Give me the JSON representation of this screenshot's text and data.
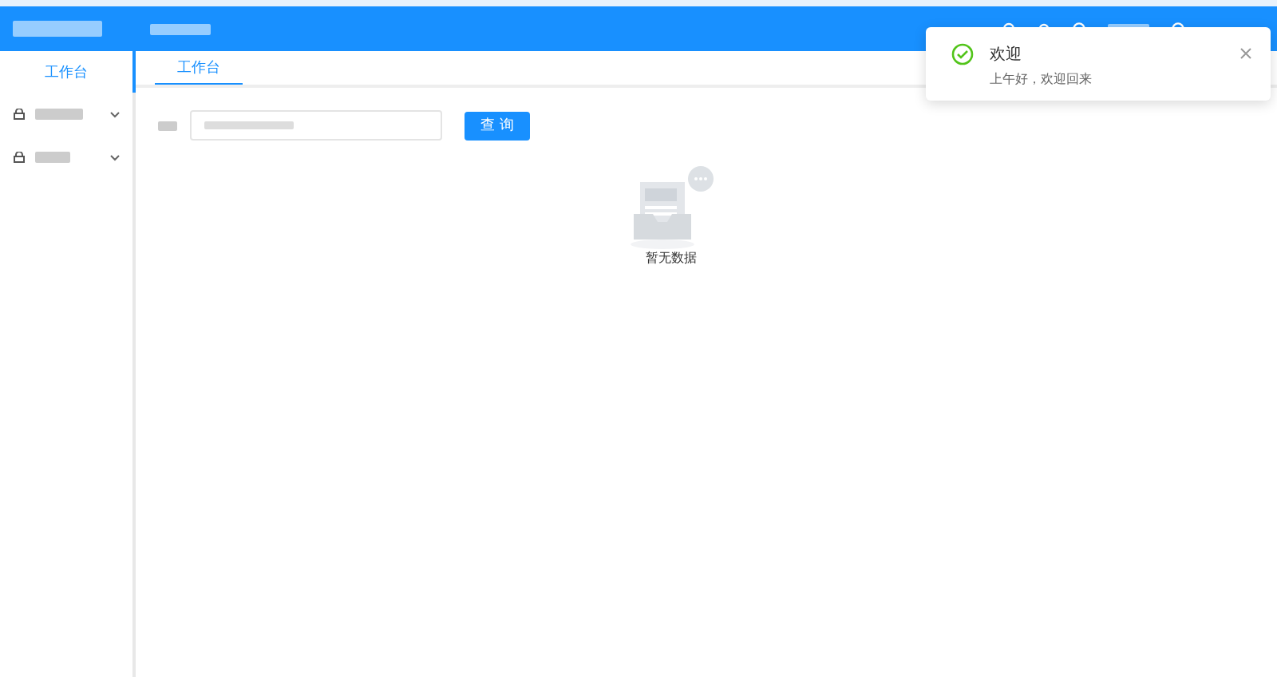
{
  "sidebar": {
    "items": [
      {
        "label": "工作台",
        "selected": true,
        "kind": "link"
      },
      {
        "kind": "group",
        "selected": false
      },
      {
        "kind": "group",
        "selected": false
      }
    ]
  },
  "tabs": [
    {
      "label": "工作台",
      "selected": true
    }
  ],
  "search": {
    "button": "查 询"
  },
  "empty": {
    "text": "暂无数据"
  },
  "notification": {
    "title": "欢迎",
    "message": "上午好，欢迎回来"
  }
}
